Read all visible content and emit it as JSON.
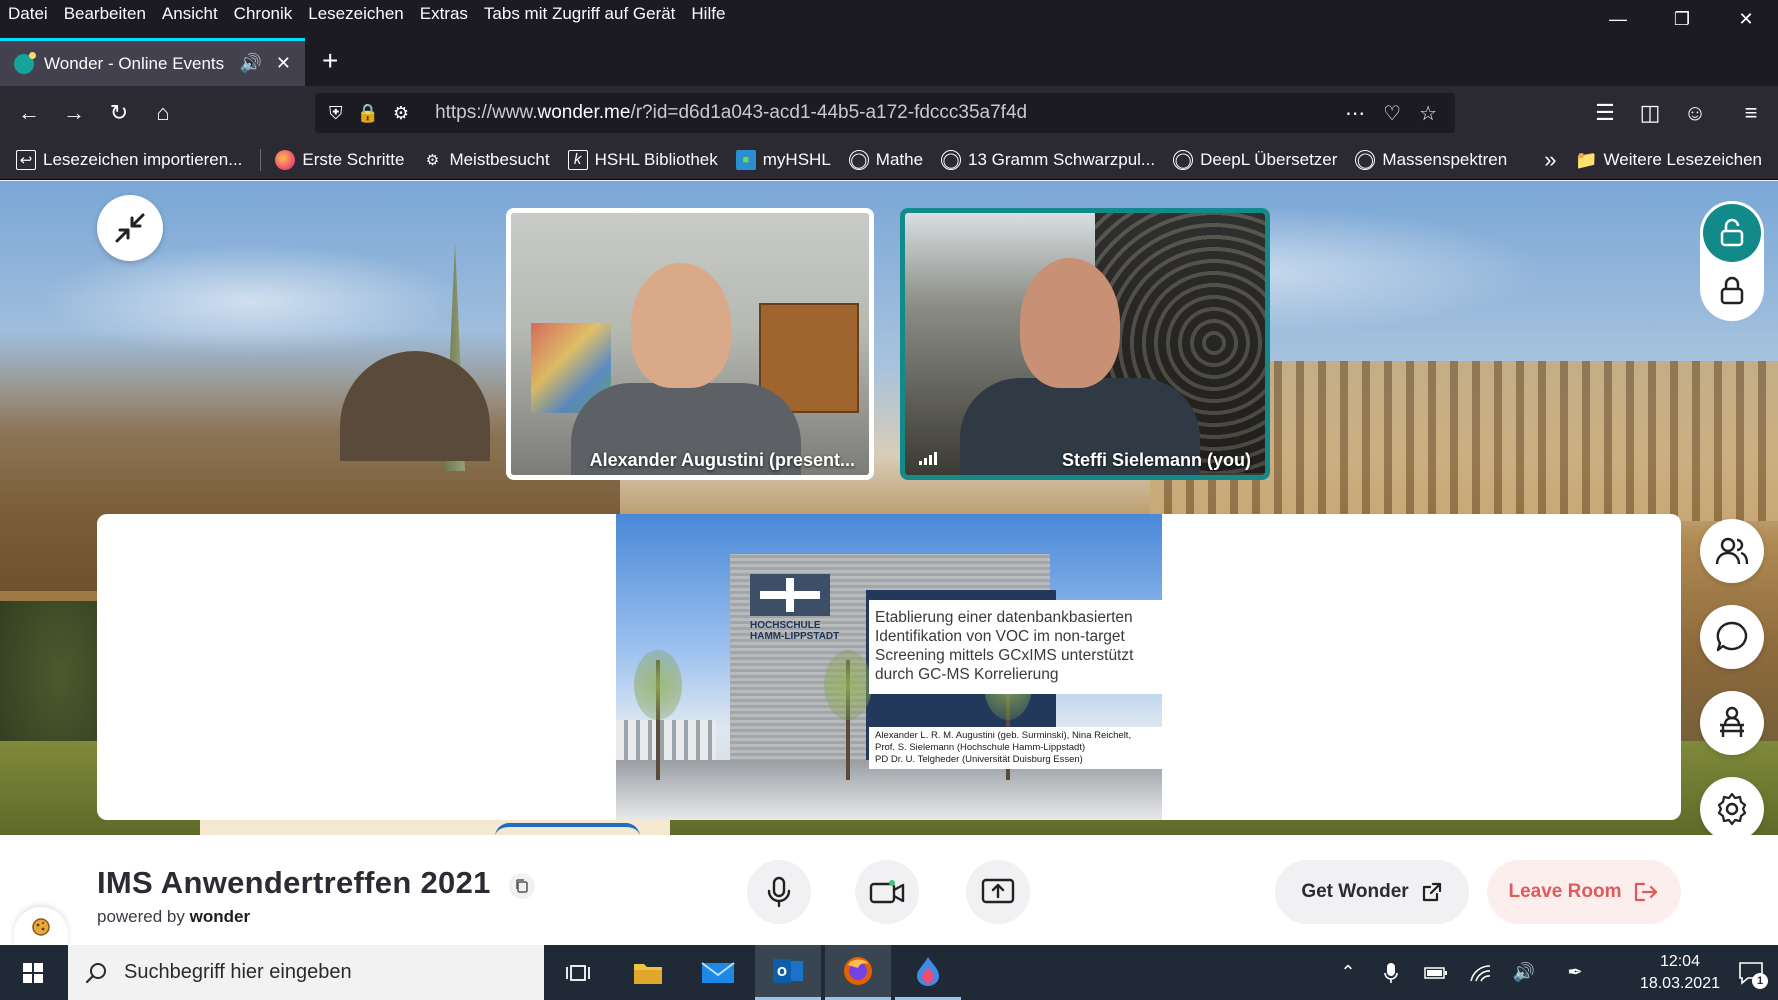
{
  "browser": {
    "menu": [
      "Datei",
      "Bearbeiten",
      "Ansicht",
      "Chronik",
      "Lesezeichen",
      "Extras",
      "Tabs mit Zugriff auf Gerät",
      "Hilfe"
    ],
    "tab_title": "Wonder - Online Events",
    "url_prefix": "https://www.",
    "url_domain": "wonder.me",
    "url_path": "/r?id=d6d1a043-acd1-44b5-a172-fdccc35a7f4d",
    "bookmarks": [
      {
        "label": "Lesezeichen importieren...",
        "icon": "import-icon"
      },
      {
        "label": "Erste Schritte",
        "icon": "firefox-icon"
      },
      {
        "label": "Meistbesucht",
        "icon": "gear-icon"
      },
      {
        "label": "HSHL Bibliothek",
        "icon": "k-logo-icon"
      },
      {
        "label": "myHSHL",
        "icon": "flag-icon"
      },
      {
        "label": "Mathe",
        "icon": "globe-icon"
      },
      {
        "label": "13 Gramm Schwarzpul...",
        "icon": "globe-icon"
      },
      {
        "label": "DeepL Übersetzer",
        "icon": "globe-icon"
      },
      {
        "label": "Massenspektren",
        "icon": "globe-icon"
      }
    ],
    "more_bookmarks": "Weitere Lesezeichen"
  },
  "room": {
    "participants": [
      {
        "name": "Alexander Augustini (present..."
      },
      {
        "name": "Steffi Sielemann (you)"
      }
    ],
    "slide": {
      "logo_text": "HOCHSCHULE HAMM-LIPPSTADT",
      "title_lines": [
        "Etablierung einer datenbankbasierten",
        "Identifikation von VOC im non-target",
        "Screening mittels GCxIMS unterstützt",
        "durch GC-MS Korrelierung"
      ],
      "author_lines": [
        "Alexander L. R. M. Augustini (geb. Surminski), Nina Reichelt,",
        "Prof. S. Sielemann (Hochschule Hamm-Lippstadt)",
        "PD Dr. U. Telgheder (Universität Duisburg Essen)"
      ]
    },
    "title": "IMS Anwendertreffen 2021",
    "powered_by": "powered by",
    "brand": "wonder",
    "get_wonder": "Get Wonder",
    "leave_room": "Leave Room"
  },
  "taskbar": {
    "search_placeholder": "Suchbegriff hier eingeben",
    "time": "12:04",
    "date": "18.03.2021",
    "notification_count": "1"
  },
  "colors": {
    "accent_teal": "#138a8a",
    "leave_red": "#e15a5a",
    "firefox_tab_highlight": "#00ddff"
  }
}
